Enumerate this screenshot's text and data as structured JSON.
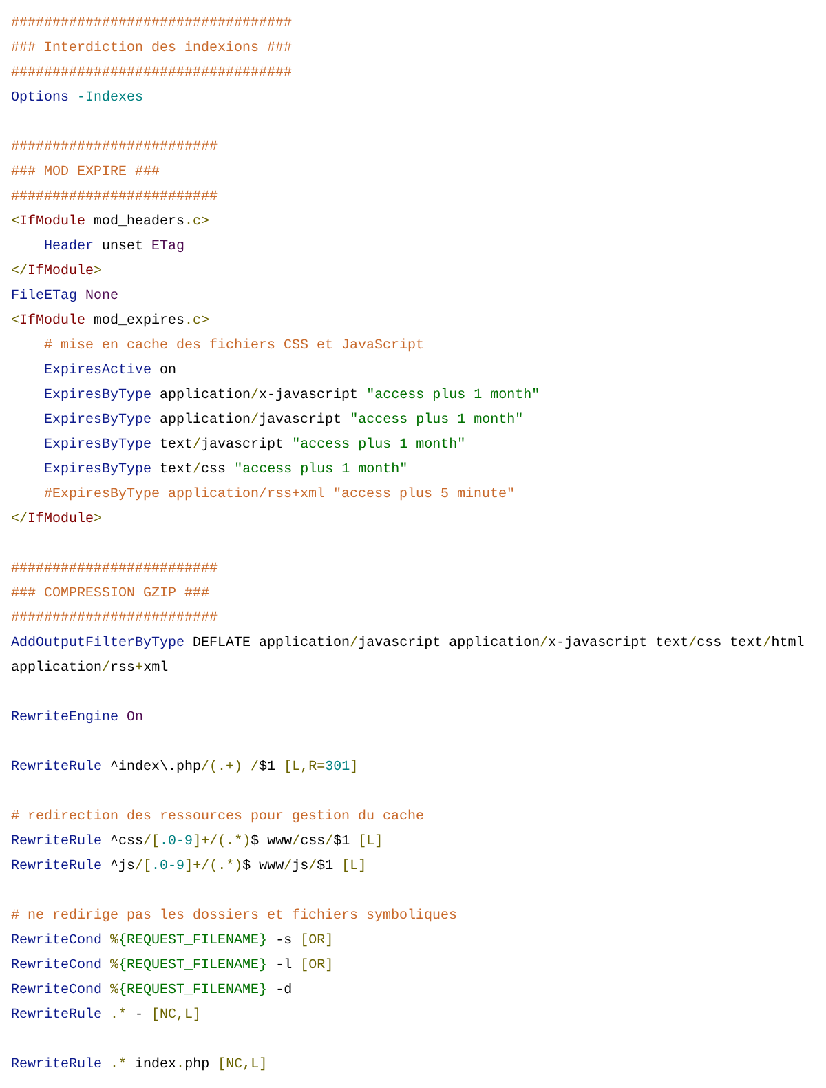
{
  "lines": [
    {
      "kind": "code",
      "tokens": [
        {
          "kind": "comment",
          "text": "##################################"
        }
      ]
    },
    {
      "kind": "code",
      "tokens": [
        {
          "kind": "comment",
          "text": "### Interdiction des indexions ###"
        }
      ]
    },
    {
      "kind": "code",
      "tokens": [
        {
          "kind": "comment",
          "text": "##################################"
        }
      ]
    },
    {
      "kind": "code",
      "tokens": [
        {
          "kind": "directive",
          "text": "Options "
        },
        {
          "kind": "number",
          "text": "-Indexes"
        }
      ]
    },
    {
      "kind": "blank"
    },
    {
      "kind": "code",
      "tokens": [
        {
          "kind": "comment",
          "text": "#########################"
        }
      ]
    },
    {
      "kind": "code",
      "tokens": [
        {
          "kind": "comment",
          "text": "### MOD EXPIRE ###"
        }
      ]
    },
    {
      "kind": "code",
      "tokens": [
        {
          "kind": "comment",
          "text": "#########################"
        }
      ]
    },
    {
      "kind": "code",
      "tokens": [
        {
          "kind": "punct",
          "text": "<"
        },
        {
          "kind": "tag",
          "text": "IfModule"
        },
        {
          "kind": "plain",
          "text": " mod_headers"
        },
        {
          "kind": "punct",
          "text": ".c>"
        }
      ],
      "children": [
        {
          "kind": "code",
          "tokens": [
            {
              "kind": "directive",
              "text": "Header "
            },
            {
              "kind": "plain",
              "text": "unset "
            },
            {
              "kind": "keyword",
              "text": "ETag"
            }
          ]
        }
      ]
    },
    {
      "kind": "code",
      "tokens": [
        {
          "kind": "punct",
          "text": "</"
        },
        {
          "kind": "tag",
          "text": "IfModule"
        },
        {
          "kind": "punct",
          "text": ">"
        }
      ]
    },
    {
      "kind": "code",
      "tokens": [
        {
          "kind": "directive",
          "text": "FileETag "
        },
        {
          "kind": "keyword",
          "text": "None"
        }
      ]
    },
    {
      "kind": "code",
      "tokens": [
        {
          "kind": "punct",
          "text": "<"
        },
        {
          "kind": "tag",
          "text": "IfModule"
        },
        {
          "kind": "plain",
          "text": " mod_expires"
        },
        {
          "kind": "punct",
          "text": ".c>"
        }
      ],
      "children": [
        {
          "kind": "code",
          "tokens": [
            {
              "kind": "comment",
              "text": "# mise en cache des fichiers CSS et JavaScript"
            }
          ]
        },
        {
          "kind": "code",
          "tokens": [
            {
              "kind": "directive",
              "text": "ExpiresActive "
            },
            {
              "kind": "plain",
              "text": "on"
            }
          ]
        },
        {
          "kind": "code",
          "tokens": [
            {
              "kind": "directive",
              "text": "ExpiresByType "
            },
            {
              "kind": "plain",
              "text": "application"
            },
            {
              "kind": "punct",
              "text": "/"
            },
            {
              "kind": "plain",
              "text": "x-javascript "
            },
            {
              "kind": "string",
              "text": "\"access plus 1 month\""
            }
          ]
        },
        {
          "kind": "code",
          "tokens": [
            {
              "kind": "directive",
              "text": "ExpiresByType "
            },
            {
              "kind": "plain",
              "text": "application"
            },
            {
              "kind": "punct",
              "text": "/"
            },
            {
              "kind": "plain",
              "text": "javascript "
            },
            {
              "kind": "string",
              "text": "\"access plus 1 month\""
            }
          ]
        },
        {
          "kind": "code",
          "tokens": [
            {
              "kind": "directive",
              "text": "ExpiresByType "
            },
            {
              "kind": "plain",
              "text": "text"
            },
            {
              "kind": "punct",
              "text": "/"
            },
            {
              "kind": "plain",
              "text": "javascript "
            },
            {
              "kind": "string",
              "text": "\"access plus 1 month\""
            }
          ]
        },
        {
          "kind": "code",
          "tokens": [
            {
              "kind": "directive",
              "text": "ExpiresByType "
            },
            {
              "kind": "plain",
              "text": "text"
            },
            {
              "kind": "punct",
              "text": "/"
            },
            {
              "kind": "plain",
              "text": "css "
            },
            {
              "kind": "string",
              "text": "\"access plus 1 month\""
            }
          ]
        },
        {
          "kind": "code",
          "tokens": [
            {
              "kind": "comment",
              "text": "#ExpiresByType application/rss+xml \"access plus 5 minute\""
            }
          ]
        }
      ]
    },
    {
      "kind": "code",
      "tokens": [
        {
          "kind": "punct",
          "text": "</"
        },
        {
          "kind": "tag",
          "text": "IfModule"
        },
        {
          "kind": "punct",
          "text": ">"
        }
      ]
    },
    {
      "kind": "blank"
    },
    {
      "kind": "code",
      "tokens": [
        {
          "kind": "comment",
          "text": "#########################"
        }
      ]
    },
    {
      "kind": "code",
      "tokens": [
        {
          "kind": "comment",
          "text": "### COMPRESSION GZIP ###"
        }
      ]
    },
    {
      "kind": "code",
      "tokens": [
        {
          "kind": "comment",
          "text": "#########################"
        }
      ]
    },
    {
      "kind": "code",
      "tokens": [
        {
          "kind": "directive",
          "text": "AddOutputFilterByType "
        },
        {
          "kind": "plain",
          "text": "DEFLATE application"
        },
        {
          "kind": "punct",
          "text": "/"
        },
        {
          "kind": "plain",
          "text": "javascript application"
        },
        {
          "kind": "punct",
          "text": "/"
        },
        {
          "kind": "plain",
          "text": "x-javascript text"
        },
        {
          "kind": "punct",
          "text": "/"
        },
        {
          "kind": "plain",
          "text": "css text"
        },
        {
          "kind": "punct",
          "text": "/"
        },
        {
          "kind": "plain",
          "text": "html"
        }
      ]
    },
    {
      "kind": "code",
      "tokens": [
        {
          "kind": "plain",
          "text": "application"
        },
        {
          "kind": "punct",
          "text": "/"
        },
        {
          "kind": "plain",
          "text": "rss"
        },
        {
          "kind": "punct",
          "text": "+"
        },
        {
          "kind": "plain",
          "text": "xml"
        }
      ]
    },
    {
      "kind": "blank"
    },
    {
      "kind": "code",
      "tokens": [
        {
          "kind": "directive",
          "text": "RewriteEngine "
        },
        {
          "kind": "keyword",
          "text": "On"
        }
      ]
    },
    {
      "kind": "blank"
    },
    {
      "kind": "code",
      "tokens": [
        {
          "kind": "directive",
          "text": "RewriteRule "
        },
        {
          "kind": "plain",
          "text": "^index\\.php"
        },
        {
          "kind": "punct",
          "text": "/(.+) /"
        },
        {
          "kind": "plain",
          "text": "$1 "
        },
        {
          "kind": "punct",
          "text": "[L,R="
        },
        {
          "kind": "number",
          "text": "301"
        },
        {
          "kind": "punct",
          "text": "]"
        }
      ]
    },
    {
      "kind": "blank"
    },
    {
      "kind": "code",
      "tokens": [
        {
          "kind": "comment",
          "text": "# redirection des ressources pour gestion du cache"
        }
      ]
    },
    {
      "kind": "code",
      "tokens": [
        {
          "kind": "directive",
          "text": "RewriteRule "
        },
        {
          "kind": "plain",
          "text": "^css"
        },
        {
          "kind": "punct",
          "text": "/["
        },
        {
          "kind": "number",
          "text": ".0-9"
        },
        {
          "kind": "punct",
          "text": "]+/(.*)"
        },
        {
          "kind": "plain",
          "text": "$ www"
        },
        {
          "kind": "punct",
          "text": "/"
        },
        {
          "kind": "plain",
          "text": "css"
        },
        {
          "kind": "punct",
          "text": "/"
        },
        {
          "kind": "plain",
          "text": "$1 "
        },
        {
          "kind": "punct",
          "text": "[L]"
        }
      ]
    },
    {
      "kind": "code",
      "tokens": [
        {
          "kind": "directive",
          "text": "RewriteRule "
        },
        {
          "kind": "plain",
          "text": "^js"
        },
        {
          "kind": "punct",
          "text": "/["
        },
        {
          "kind": "number",
          "text": ".0-9"
        },
        {
          "kind": "punct",
          "text": "]+/(.*)"
        },
        {
          "kind": "plain",
          "text": "$ www"
        },
        {
          "kind": "punct",
          "text": "/"
        },
        {
          "kind": "plain",
          "text": "js"
        },
        {
          "kind": "punct",
          "text": "/"
        },
        {
          "kind": "plain",
          "text": "$1 "
        },
        {
          "kind": "punct",
          "text": "[L]"
        }
      ]
    },
    {
      "kind": "blank"
    },
    {
      "kind": "code",
      "tokens": [
        {
          "kind": "comment",
          "text": "# ne redirige pas les dossiers et fichiers symboliques"
        }
      ]
    },
    {
      "kind": "code",
      "tokens": [
        {
          "kind": "directive",
          "text": "RewriteCond "
        },
        {
          "kind": "punct",
          "text": "%"
        },
        {
          "kind": "string",
          "text": "{REQUEST_FILENAME}"
        },
        {
          "kind": "plain",
          "text": " -s "
        },
        {
          "kind": "punct",
          "text": "[OR]"
        }
      ]
    },
    {
      "kind": "code",
      "tokens": [
        {
          "kind": "directive",
          "text": "RewriteCond "
        },
        {
          "kind": "punct",
          "text": "%"
        },
        {
          "kind": "string",
          "text": "{REQUEST_FILENAME}"
        },
        {
          "kind": "plain",
          "text": " -l "
        },
        {
          "kind": "punct",
          "text": "[OR]"
        }
      ]
    },
    {
      "kind": "code",
      "tokens": [
        {
          "kind": "directive",
          "text": "RewriteCond "
        },
        {
          "kind": "punct",
          "text": "%"
        },
        {
          "kind": "string",
          "text": "{REQUEST_FILENAME}"
        },
        {
          "kind": "plain",
          "text": " -d"
        }
      ]
    },
    {
      "kind": "code",
      "tokens": [
        {
          "kind": "directive",
          "text": "RewriteRule "
        },
        {
          "kind": "punct",
          "text": ".*"
        },
        {
          "kind": "plain",
          "text": " - "
        },
        {
          "kind": "punct",
          "text": "[NC,L]"
        }
      ]
    },
    {
      "kind": "blank"
    },
    {
      "kind": "code",
      "tokens": [
        {
          "kind": "directive",
          "text": "RewriteRule "
        },
        {
          "kind": "punct",
          "text": ".*"
        },
        {
          "kind": "plain",
          "text": " index"
        },
        {
          "kind": "punct",
          "text": "."
        },
        {
          "kind": "plain",
          "text": "php "
        },
        {
          "kind": "punct",
          "text": "[NC,L]"
        }
      ]
    }
  ]
}
